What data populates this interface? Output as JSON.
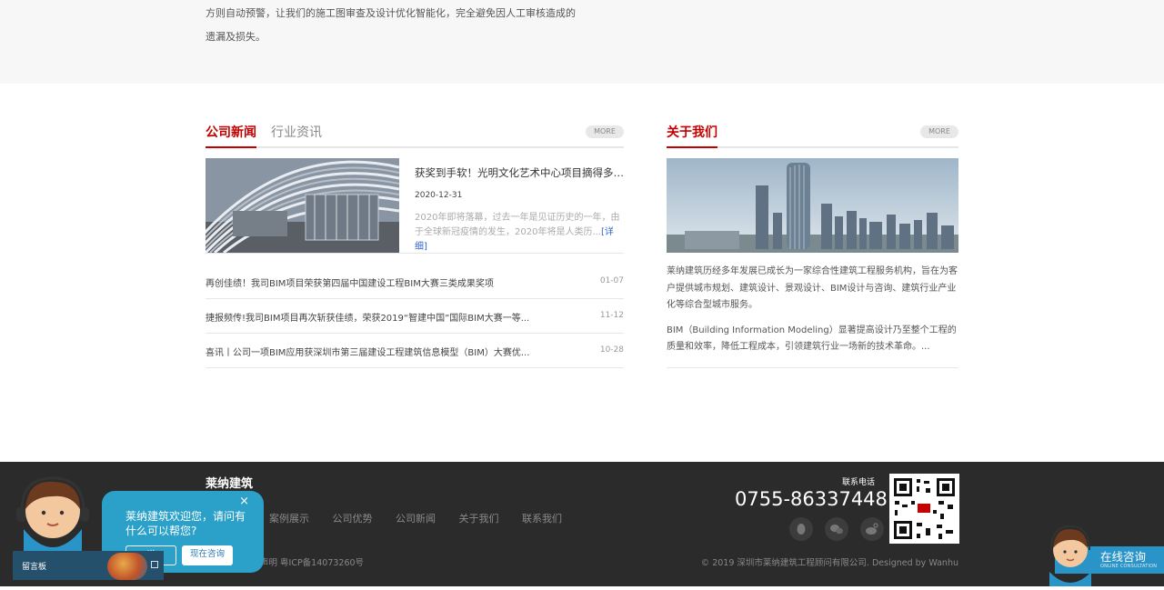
{
  "intro": {
    "text": "方则自动预警，让我们的施工图审查及设计优化智能化，完全避免因人工审核造成的遗漏及损失。"
  },
  "news": {
    "tabs": [
      {
        "label": "公司新闻"
      },
      {
        "label": "行业资讯"
      }
    ],
    "more_label": "MORE",
    "featured": {
      "title": "获奖到手软！光明文化艺术中心项目摘得多项...",
      "date": "2020-12-31",
      "summary": "2020年即将落幕，过去一年是见证历史的一年，由于全球新冠疫情的发生，2020年将是人类历...",
      "detail_link": "[详细]"
    },
    "items": [
      {
        "title": "再创佳绩！我司BIM项目荣获第四届中国建设工程BIM大赛三类成果奖项",
        "date": "01-07"
      },
      {
        "title": "捷报频传!我司BIM项目再次斩获佳绩，荣获2019“智建中国”国际BIM大赛一等...",
        "date": "11-12"
      },
      {
        "title": "喜讯丨公司一项BIM应用获深圳市第三届建设工程建筑信息模型（BIM）大赛优...",
        "date": "10-28"
      }
    ]
  },
  "about": {
    "title": "关于我们",
    "more_label": "MORE",
    "para1": "莱纳建筑历经多年发展已成长为一家综合性建筑工程服务机构，旨在为客户提供城市规划、建筑设计、景观设计、BIM设计与咨询、建筑行业产业化等综合型城市服务。",
    "para2": "BIM（Building Information Modeling）显著提高设计乃至整个工程的质量和效率，降低工程成本，引领建筑行业一场新的技术革命。..."
  },
  "footer": {
    "brand": "莱纳建筑",
    "nav": [
      {
        "label": "案例展示"
      },
      {
        "label": "公司优势"
      },
      {
        "label": "公司新闻"
      },
      {
        "label": "关于我们"
      },
      {
        "label": "联系我们"
      }
    ],
    "legal": "声明   粤ICP备14073260号",
    "copyright": "© 2019 深圳市莱纳建筑工程顾问有限公司. Designed by Wanhu",
    "tel_label": "联系电话",
    "tel": "0755-86337448",
    "social_icons": [
      "qq-icon",
      "wechat-icon",
      "weibo-icon"
    ]
  },
  "chat": {
    "message": "莱纳建筑欢迎您，请问有什么可以帮您?",
    "close_glyph": "×",
    "later_label": "说",
    "now_label": "现在咨询",
    "guestbook_label": "留言板"
  },
  "online": {
    "label": "在线咨询",
    "sublabel": "ONLINE CONSULTATION"
  }
}
